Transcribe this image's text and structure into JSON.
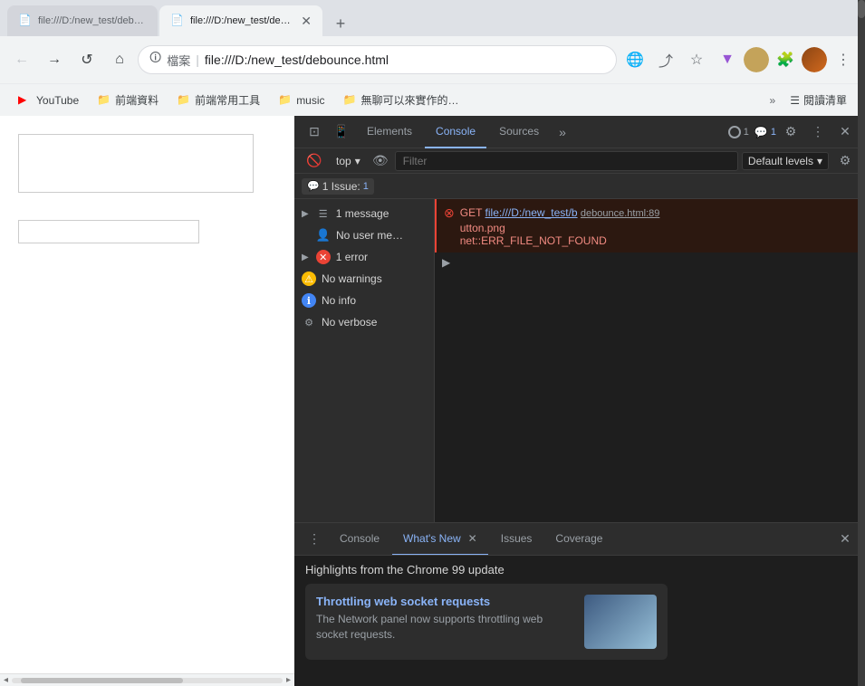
{
  "browser": {
    "tabs": [
      {
        "id": "tab1",
        "title": "file:///D:/new_test/debounce.html",
        "favicon": "📄",
        "active": false
      },
      {
        "id": "tab2",
        "title": "file:///D:/new_test/debounce.html",
        "favicon": "📄",
        "active": true
      },
      {
        "id": "tab3",
        "title": "+",
        "favicon": "",
        "active": false
      }
    ],
    "address": "file:///D:/new_test/debounce.html",
    "address_label": "檔案",
    "bookmarks": [
      {
        "id": "bm1",
        "label": "YouTube",
        "icon": "▶",
        "color": "#ff0000"
      },
      {
        "id": "bm2",
        "label": "前端資料",
        "icon": "📁",
        "color": "#e6a817"
      },
      {
        "id": "bm3",
        "label": "前端常用工具",
        "icon": "📁",
        "color": "#e6a817"
      },
      {
        "id": "bm4",
        "label": "music",
        "icon": "📁",
        "color": "#e6a817"
      },
      {
        "id": "bm5",
        "label": "無聊可以來實作的…",
        "icon": "📁",
        "color": "#e6a817"
      }
    ],
    "reading_list_label": "閱讀清單"
  },
  "devtools": {
    "tabs": [
      "Elements",
      "Console",
      "Sources"
    ],
    "active_tab": "Console",
    "issues_count": "1",
    "issues_label": "1 Issue:",
    "badge_1_count": "1",
    "badge_2_count": "1",
    "context": "top",
    "filter_placeholder": "Filter",
    "default_levels_label": "Default levels",
    "console_sidebar": [
      {
        "id": "messages",
        "label": "1 message",
        "icon": "☰",
        "icon_type": "message",
        "expandable": true
      },
      {
        "id": "user-messages",
        "label": "No user me…",
        "icon": "👤",
        "icon_type": "user"
      },
      {
        "id": "errors",
        "label": "1 error",
        "icon": "✕",
        "icon_type": "error",
        "expandable": true
      },
      {
        "id": "warnings",
        "label": "No warnings",
        "icon": "⚠",
        "icon_type": "warning"
      },
      {
        "id": "info",
        "label": "No info",
        "icon": "ℹ",
        "icon_type": "info"
      },
      {
        "id": "verbose",
        "label": "No verbose",
        "icon": "⚙",
        "icon_type": "verbose"
      }
    ],
    "console_entries": [
      {
        "type": "error",
        "method": "GET",
        "url_part1": "file:///D:/new_test/b",
        "url_part2": "debounce.html:89",
        "url_part3": "utton.png",
        "error_code": "net::ERR_FILE_NOT_FOUND",
        "has_arrow": true
      }
    ]
  },
  "bottom_panel": {
    "tabs": [
      {
        "id": "console-tab",
        "label": "Console",
        "active": false,
        "closeable": false
      },
      {
        "id": "whats-new-tab",
        "label": "What's New",
        "active": true,
        "closeable": true
      },
      {
        "id": "issues-tab",
        "label": "Issues",
        "active": false,
        "closeable": false
      },
      {
        "id": "coverage-tab",
        "label": "Coverage",
        "active": false,
        "closeable": false
      }
    ],
    "whats_new": {
      "title": "Highlights from the Chrome 99 update",
      "card_title": "Throttling web socket requests",
      "card_desc": "The Network panel now supports throttling web socket requests.",
      "card_img_alt": "web socket throttling preview"
    }
  }
}
